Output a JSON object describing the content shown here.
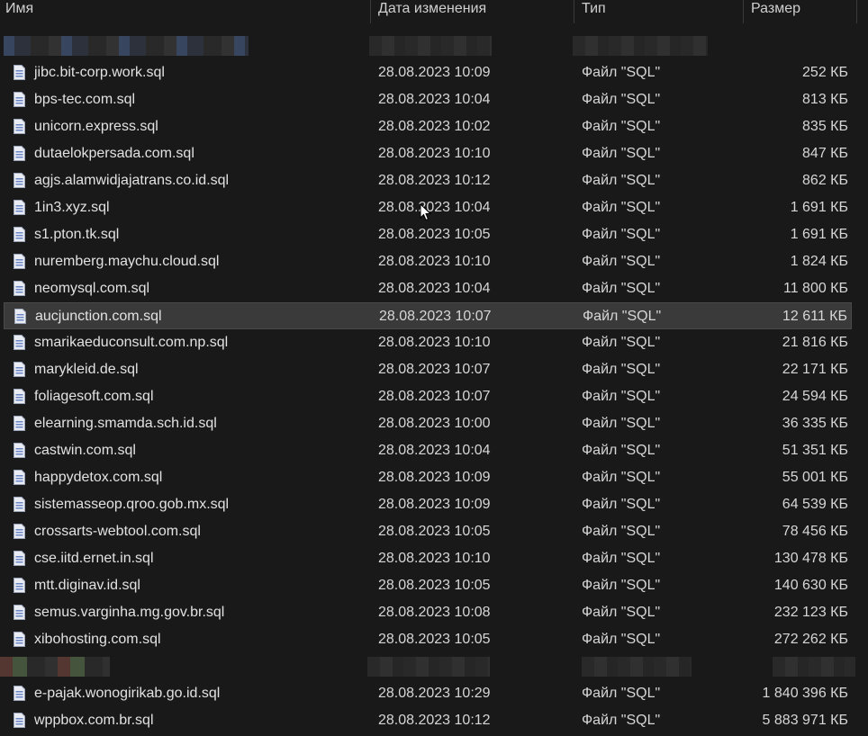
{
  "columns": {
    "name": "Имя",
    "date": "Дата изменения",
    "type": "Тип",
    "size": "Размер"
  },
  "icons": {
    "file": "sql-file-icon",
    "cursor": "mouse-pointer-icon"
  },
  "colors": {
    "background": "#191919",
    "selected_row": "#3a3a3a",
    "text": "#dcdcdc",
    "icon_accent": "#6b86c6"
  },
  "group1": {
    "files": [
      {
        "name": "jibc.bit-corp.work.sql",
        "date": "28.08.2023 10:09",
        "type": "Файл \"SQL\"",
        "size": "252 КБ"
      },
      {
        "name": "bps-tec.com.sql",
        "date": "28.08.2023 10:04",
        "type": "Файл \"SQL\"",
        "size": "813 КБ"
      },
      {
        "name": "unicorn.express.sql",
        "date": "28.08.2023 10:02",
        "type": "Файл \"SQL\"",
        "size": "835 КБ"
      },
      {
        "name": "dutaelokpersada.com.sql",
        "date": "28.08.2023 10:10",
        "type": "Файл \"SQL\"",
        "size": "847 КБ"
      },
      {
        "name": "agjs.alamwidjajatrans.co.id.sql",
        "date": "28.08.2023 10:12",
        "type": "Файл \"SQL\"",
        "size": "862 КБ"
      },
      {
        "name": "1in3.xyz.sql",
        "date": "28.08.2023 10:04",
        "type": "Файл \"SQL\"",
        "size": "1 691 КБ"
      },
      {
        "name": "s1.pton.tk.sql",
        "date": "28.08.2023 10:05",
        "type": "Файл \"SQL\"",
        "size": "1 691 КБ"
      },
      {
        "name": "nuremberg.maychu.cloud.sql",
        "date": "28.08.2023 10:10",
        "type": "Файл \"SQL\"",
        "size": "1 824 КБ"
      },
      {
        "name": "neomysql.com.sql",
        "date": "28.08.2023 10:04",
        "type": "Файл \"SQL\"",
        "size": "11 800 КБ"
      },
      {
        "name": "aucjunction.com.sql",
        "date": "28.08.2023 10:07",
        "type": "Файл \"SQL\"",
        "size": "12 611 КБ"
      },
      {
        "name": "smarikaeduconsult.com.np.sql",
        "date": "28.08.2023 10:10",
        "type": "Файл \"SQL\"",
        "size": "21 816 КБ"
      },
      {
        "name": "marykleid.de.sql",
        "date": "28.08.2023 10:07",
        "type": "Файл \"SQL\"",
        "size": "22 171 КБ"
      },
      {
        "name": "foliagesoft.com.sql",
        "date": "28.08.2023 10:07",
        "type": "Файл \"SQL\"",
        "size": "24 594 КБ"
      },
      {
        "name": "elearning.smamda.sch.id.sql",
        "date": "28.08.2023 10:00",
        "type": "Файл \"SQL\"",
        "size": "36 335 КБ"
      },
      {
        "name": "castwin.com.sql",
        "date": "28.08.2023 10:04",
        "type": "Файл \"SQL\"",
        "size": "51 351 КБ"
      },
      {
        "name": "happydetox.com.sql",
        "date": "28.08.2023 10:09",
        "type": "Файл \"SQL\"",
        "size": "55 001 КБ"
      },
      {
        "name": "sistemasseop.qroo.gob.mx.sql",
        "date": "28.08.2023 10:09",
        "type": "Файл \"SQL\"",
        "size": "64 539 КБ"
      },
      {
        "name": "crossarts-webtool.com.sql",
        "date": "28.08.2023 10:05",
        "type": "Файл \"SQL\"",
        "size": "78 456 КБ"
      },
      {
        "name": "cse.iitd.ernet.in.sql",
        "date": "28.08.2023 10:10",
        "type": "Файл \"SQL\"",
        "size": "130 478 КБ"
      },
      {
        "name": "mtt.diginav.id.sql",
        "date": "28.08.2023 10:05",
        "type": "Файл \"SQL\"",
        "size": "140 630 КБ"
      },
      {
        "name": "semus.varginha.mg.gov.br.sql",
        "date": "28.08.2023 10:08",
        "type": "Файл \"SQL\"",
        "size": "232 123 КБ"
      },
      {
        "name": "xibohosting.com.sql",
        "date": "28.08.2023 10:05",
        "type": "Файл \"SQL\"",
        "size": "272 262 КБ"
      }
    ]
  },
  "group2": {
    "files": [
      {
        "name": "e-pajak.wonogirikab.go.id.sql",
        "date": "28.08.2023 10:29",
        "type": "Файл \"SQL\"",
        "size": "1 840 396 КБ"
      },
      {
        "name": "wppbox.com.br.sql",
        "date": "28.08.2023 10:12",
        "type": "Файл \"SQL\"",
        "size": "5 883 971 КБ"
      }
    ]
  }
}
